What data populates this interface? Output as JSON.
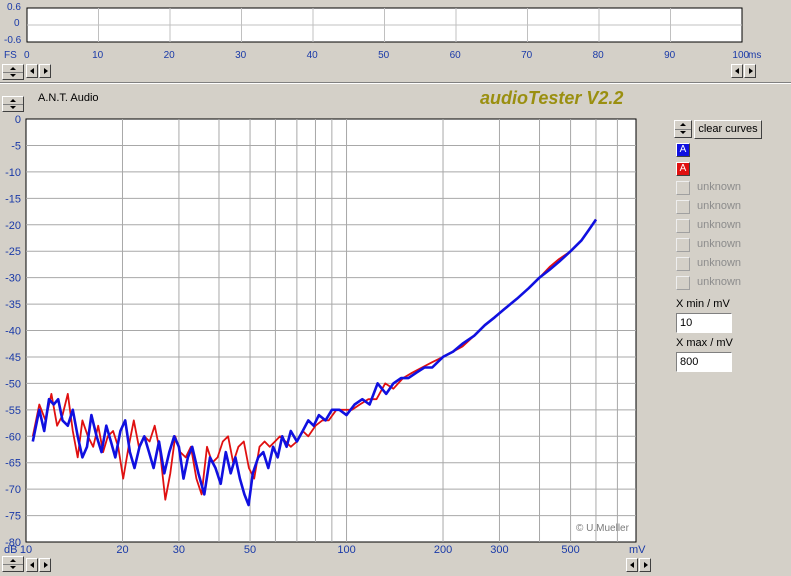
{
  "scope": {
    "y_ticks": [
      "0.6",
      "0",
      "-0.6"
    ],
    "y_unit": "FS",
    "x_ticks": [
      "0",
      "10",
      "20",
      "30",
      "40",
      "50",
      "60",
      "70",
      "80",
      "90",
      "100"
    ],
    "x_unit": "ms"
  },
  "header": {
    "brand": "A.N.T. Audio",
    "app_title": "audioTester V2.2"
  },
  "controls": {
    "clear_label": "clear curves",
    "channels": [
      {
        "label": "A",
        "color": "#1010e0"
      },
      {
        "label": "A",
        "color": "#e01010"
      }
    ],
    "unknown_items": [
      "unknown",
      "unknown",
      "unknown",
      "unknown",
      "unknown",
      "unknown"
    ],
    "xmin_label": "X min / mV",
    "xmin_value": "10",
    "xmax_label": "X max / mV",
    "xmax_value": "800"
  },
  "chart_data": {
    "type": "line",
    "x_scale": "log",
    "xlim": [
      10,
      800
    ],
    "ylim": [
      -80,
      0
    ],
    "ylabel": "dB",
    "xlabel": "mV",
    "x_tick_labels": [
      "10",
      "20",
      "30",
      "50",
      "100",
      "200",
      "300",
      "500"
    ],
    "y_tick_labels": [
      "0",
      "-5",
      "-10",
      "-15",
      "-20",
      "-25",
      "-30",
      "-35",
      "-40",
      "-45",
      "-50",
      "-55",
      "-60",
      "-65",
      "-70",
      "-75",
      "-80"
    ],
    "grid": true,
    "copyright": "© U.Mueller",
    "series": [
      {
        "color": "#1010e0",
        "x": [
          10.5,
          11,
          11.4,
          11.8,
          12.2,
          12.6,
          13,
          13.5,
          14,
          14.5,
          15,
          15.5,
          16,
          16.6,
          17.2,
          17.8,
          18.4,
          19,
          19.7,
          20.4,
          21.1,
          21.8,
          22.6,
          23.4,
          24.2,
          25,
          26,
          27,
          28,
          29,
          30,
          31,
          32,
          33,
          34.5,
          36,
          37.5,
          39,
          40.5,
          42,
          43.5,
          45,
          46.5,
          48,
          49.5,
          51,
          53,
          55,
          57,
          59,
          61,
          63,
          65,
          67,
          70,
          73,
          76,
          79,
          82,
          86,
          90,
          95,
          100,
          106,
          112,
          118,
          125,
          133,
          140,
          148,
          156,
          165,
          175,
          185,
          200,
          215,
          230,
          250,
          270,
          290,
          310,
          340,
          370,
          400,
          430,
          460,
          500,
          540,
          570,
          600
        ],
        "y": [
          -61,
          -55,
          -59,
          -53,
          -54,
          -53,
          -57,
          -58,
          -55,
          -60,
          -64,
          -62,
          -56,
          -60,
          -63,
          -58,
          -61,
          -64,
          -59,
          -57,
          -63,
          -66,
          -62,
          -60,
          -63,
          -66,
          -61,
          -67,
          -63,
          -60,
          -62,
          -68,
          -64,
          -62,
          -67,
          -71,
          -64,
          -66,
          -69,
          -63,
          -67,
          -64,
          -68,
          -71,
          -73,
          -67,
          -64,
          -63,
          -66,
          -62,
          -64,
          -60,
          -62,
          -59,
          -61,
          -59,
          -57,
          -58,
          -56,
          -57,
          -55,
          -55,
          -56,
          -54,
          -53,
          -54,
          -50,
          -52,
          -50,
          -49,
          -49,
          -48,
          -47,
          -47,
          -45,
          -44,
          -42.5,
          -41,
          -39,
          -37.5,
          -36,
          -34,
          -32,
          -30,
          -28.5,
          -27,
          -25,
          -23,
          -21,
          -19
        ]
      },
      {
        "color": "#e01010",
        "x": [
          10.5,
          11,
          11.5,
          12,
          12.5,
          13,
          13.5,
          14,
          14.5,
          15,
          15.6,
          16.2,
          16.8,
          17.4,
          18,
          18.7,
          19.4,
          20.1,
          20.9,
          21.7,
          22.5,
          23.4,
          24.3,
          25.2,
          26.2,
          27.2,
          28.2,
          29.2,
          30.3,
          31.5,
          32.7,
          34,
          35.3,
          36.7,
          38.1,
          39.6,
          41.1,
          42.7,
          44.3,
          46,
          47.8,
          49.6,
          51.5,
          53.5,
          55.5,
          57.6,
          59.8,
          62,
          64.5,
          67,
          70,
          73,
          76,
          80,
          84,
          88,
          93,
          98,
          104,
          110,
          117,
          124,
          132,
          140,
          150,
          160,
          172,
          185,
          200,
          215,
          230,
          250,
          270,
          290,
          310,
          340,
          370,
          400,
          430,
          460,
          500,
          540,
          570,
          600
        ],
        "y": [
          -60,
          -54,
          -57,
          -52,
          -58,
          -56,
          -52,
          -59,
          -64,
          -57,
          -60,
          -62,
          -58,
          -63,
          -60,
          -59,
          -62,
          -68,
          -62,
          -57,
          -62,
          -60,
          -61,
          -58,
          -63,
          -72,
          -67,
          -60,
          -63,
          -64,
          -62,
          -68,
          -71,
          -62,
          -65,
          -64,
          -61,
          -60,
          -65,
          -62,
          -61,
          -66,
          -68,
          -62,
          -61,
          -62,
          -61,
          -60,
          -61,
          -62,
          -61,
          -59,
          -60,
          -58,
          -57,
          -57,
          -55,
          -55,
          -55,
          -54,
          -53,
          -53,
          -50,
          -51,
          -49,
          -48,
          -47,
          -46,
          -45,
          -44,
          -43,
          -41,
          -39,
          -37.5,
          -36,
          -34,
          -32,
          -30,
          -28,
          -26.5,
          -25,
          -23,
          -21,
          -19
        ]
      }
    ]
  }
}
